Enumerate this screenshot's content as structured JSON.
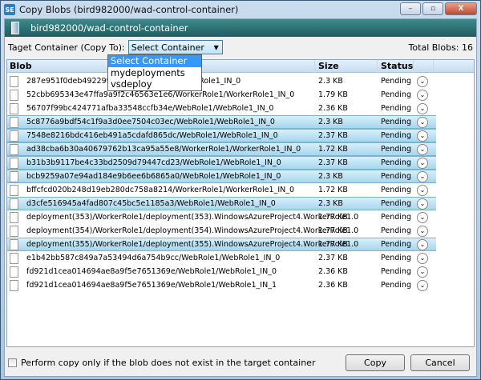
{
  "window": {
    "title": "Copy Blobs (bird982000/wad-control-container)",
    "minimize": "–",
    "maximize": "▫",
    "close": "X",
    "app_icon": "SE"
  },
  "header": {
    "path": "bird982000/wad-control-container"
  },
  "toolbar": {
    "target_label": "Taget Container (Copy To):",
    "selected": "Select Container",
    "total_label": "Total Blobs: 16"
  },
  "dropdown": {
    "options": [
      "Select Container",
      "mydeployments",
      "vsdeploy"
    ]
  },
  "grid": {
    "columns": [
      "Blob",
      "Size",
      "Status",
      ""
    ],
    "rows": [
      {
        "blob": "287e951f0deb492299e98c67/WebRole1/WebRole1_IN_0",
        "size": "2.3 KB",
        "status": "Pending",
        "selected": false
      },
      {
        "blob": "52cbb695343e47ffa9a9f2c46563e1e6/WorkerRole1/WorkerRole1_IN_0",
        "size": "1.79 KB",
        "status": "Pending",
        "selected": false
      },
      {
        "blob": "56707f99bc424771afba33548ccfb34e/WebRole1/WebRole1_IN_0",
        "size": "2.36 KB",
        "status": "Pending",
        "selected": false
      },
      {
        "blob": "5c8776a9bdf54c1f9a3d0ee7504c03ec/WebRole1/WebRole1_IN_0",
        "size": "2.3 KB",
        "status": "Pending",
        "selected": true
      },
      {
        "blob": "7548e8216bdc416eb491a5cdafd865dc/WebRole1/WebRole1_IN_0",
        "size": "2.37 KB",
        "status": "Pending",
        "selected": true
      },
      {
        "blob": "ad38cba6b30a40679762b13ca95a55e8/WorkerRole1/WorkerRole1_IN_0",
        "size": "1.72 KB",
        "status": "Pending",
        "selected": true
      },
      {
        "blob": "b31b3b9117be4c33bd2509d79447cd23/WebRole1/WebRole1_IN_0",
        "size": "2.37 KB",
        "status": "Pending",
        "selected": true
      },
      {
        "blob": "bcb9259a07e94ad184e9b6ee6b6865a0/WebRole1/WebRole1_IN_0",
        "size": "2.3 KB",
        "status": "Pending",
        "selected": true
      },
      {
        "blob": "bffcfcd020b248d19eb280dc758a8214/WorkerRole1/WorkerRole1_IN_0",
        "size": "1.72 KB",
        "status": "Pending",
        "selected": false
      },
      {
        "blob": "d3cfe516945a4fad807c45bc5e1185a3/WebRole1/WebRole1_IN_0",
        "size": "2.3 KB",
        "status": "Pending",
        "selected": true
      },
      {
        "blob": "deployment(353)/WorkerRole1/deployment(353).WindowsAzureProject4.WorkerRole1.0",
        "size": "1.77 KB",
        "status": "Pending",
        "selected": false
      },
      {
        "blob": "deployment(354)/WorkerRole1/deployment(354).WindowsAzureProject4.WorkerRole1.0",
        "size": "1.77 KB",
        "status": "Pending",
        "selected": false
      },
      {
        "blob": "deployment(355)/WorkerRole1/deployment(355).WindowsAzureProject4.WorkerRole1.0",
        "size": "1.77 KB",
        "status": "Pending",
        "selected": true
      },
      {
        "blob": "e1b42bb587c849a7a53494d6a754b9cc/WebRole1/WebRole1_IN_0",
        "size": "2.37 KB",
        "status": "Pending",
        "selected": false
      },
      {
        "blob": "fd921d1cea014694ae8a9f5e7651369e/WebRole1/WebRole1_IN_0",
        "size": "2.36 KB",
        "status": "Pending",
        "selected": false
      },
      {
        "blob": "fd921d1cea014694ae8a9f5e7651369e/WebRole1/WebRole1_IN_1",
        "size": "2.36 KB",
        "status": "Pending",
        "selected": false
      }
    ]
  },
  "footer": {
    "checkbox_label": "Perform copy only if the blob does not exist in the target container",
    "checked": false,
    "copy": "Copy",
    "cancel": "Cancel"
  }
}
